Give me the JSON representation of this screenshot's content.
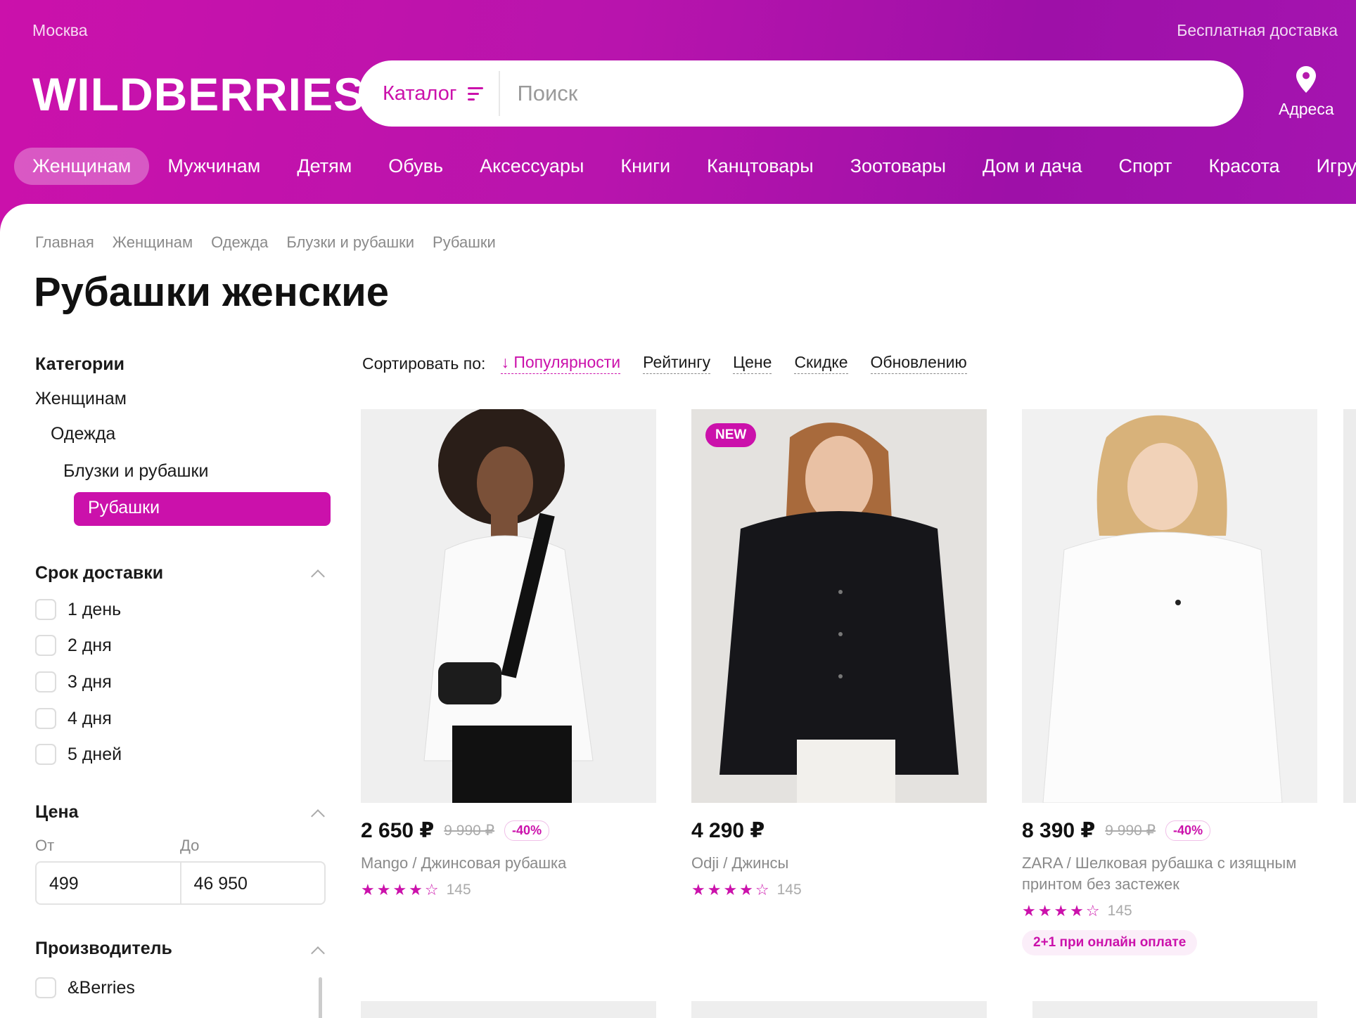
{
  "header": {
    "city": "Москва",
    "free_delivery": "Бесплатная доставка",
    "logo": "WILDBERRIES",
    "catalog_label": "Каталог",
    "search_placeholder": "Поиск",
    "address_label": "Адреса"
  },
  "nav": [
    "Женщинам",
    "Мужчинам",
    "Детям",
    "Обувь",
    "Аксессуары",
    "Книги",
    "Канцтовары",
    "Зоотовары",
    "Дом и дача",
    "Спорт",
    "Красота",
    "Игруш"
  ],
  "breadcrumbs": [
    "Главная",
    "Женщинам",
    "Одежда",
    "Блузки и рубашки",
    "Рубашки"
  ],
  "page_title": "Рубашки женские",
  "categories": {
    "heading": "Категории",
    "level1": "Женщинам",
    "level2": "Одежда",
    "level3": "Блузки и рубашки",
    "active": "Рубашки"
  },
  "delivery": {
    "heading": "Срок доставки",
    "options": [
      "1 день",
      "2 дня",
      "3 дня",
      "4 дня",
      "5 дней"
    ]
  },
  "price_filter": {
    "heading": "Цена",
    "from_label": "От",
    "to_label": "До",
    "from_value": "499",
    "to_value": "46 950"
  },
  "manufacturer": {
    "heading": "Производитель",
    "options": [
      "&Berries"
    ]
  },
  "sort": {
    "label": "Сортировать по:",
    "options": [
      "↓ Популярности",
      "Рейтингу",
      "Цене",
      "Скидке",
      "Обновлению"
    ]
  },
  "products": [
    {
      "price": "2 650 ₽",
      "old_price": "9 990 ₽",
      "discount": "-40%",
      "title": "Mango / Джинсовая рубашка",
      "stars": "★★★★☆",
      "rating": 4,
      "reviews": "145"
    },
    {
      "price": "4 290 ₽",
      "badge": "NEW",
      "title": "Odji / Джинсы",
      "stars": "★★★★☆",
      "rating": 4,
      "reviews": "145"
    },
    {
      "price": "8 390 ₽",
      "old_price": "9 990 ₽",
      "discount": "-40%",
      "title": "ZARA / Шелковая рубашка с изящным принтом без застежек",
      "stars": "★★★★☆",
      "rating": 4,
      "reviews": "145",
      "promo": "2+1 при онлайн оплате"
    }
  ],
  "colors": {
    "brand": "#cb11ab"
  }
}
